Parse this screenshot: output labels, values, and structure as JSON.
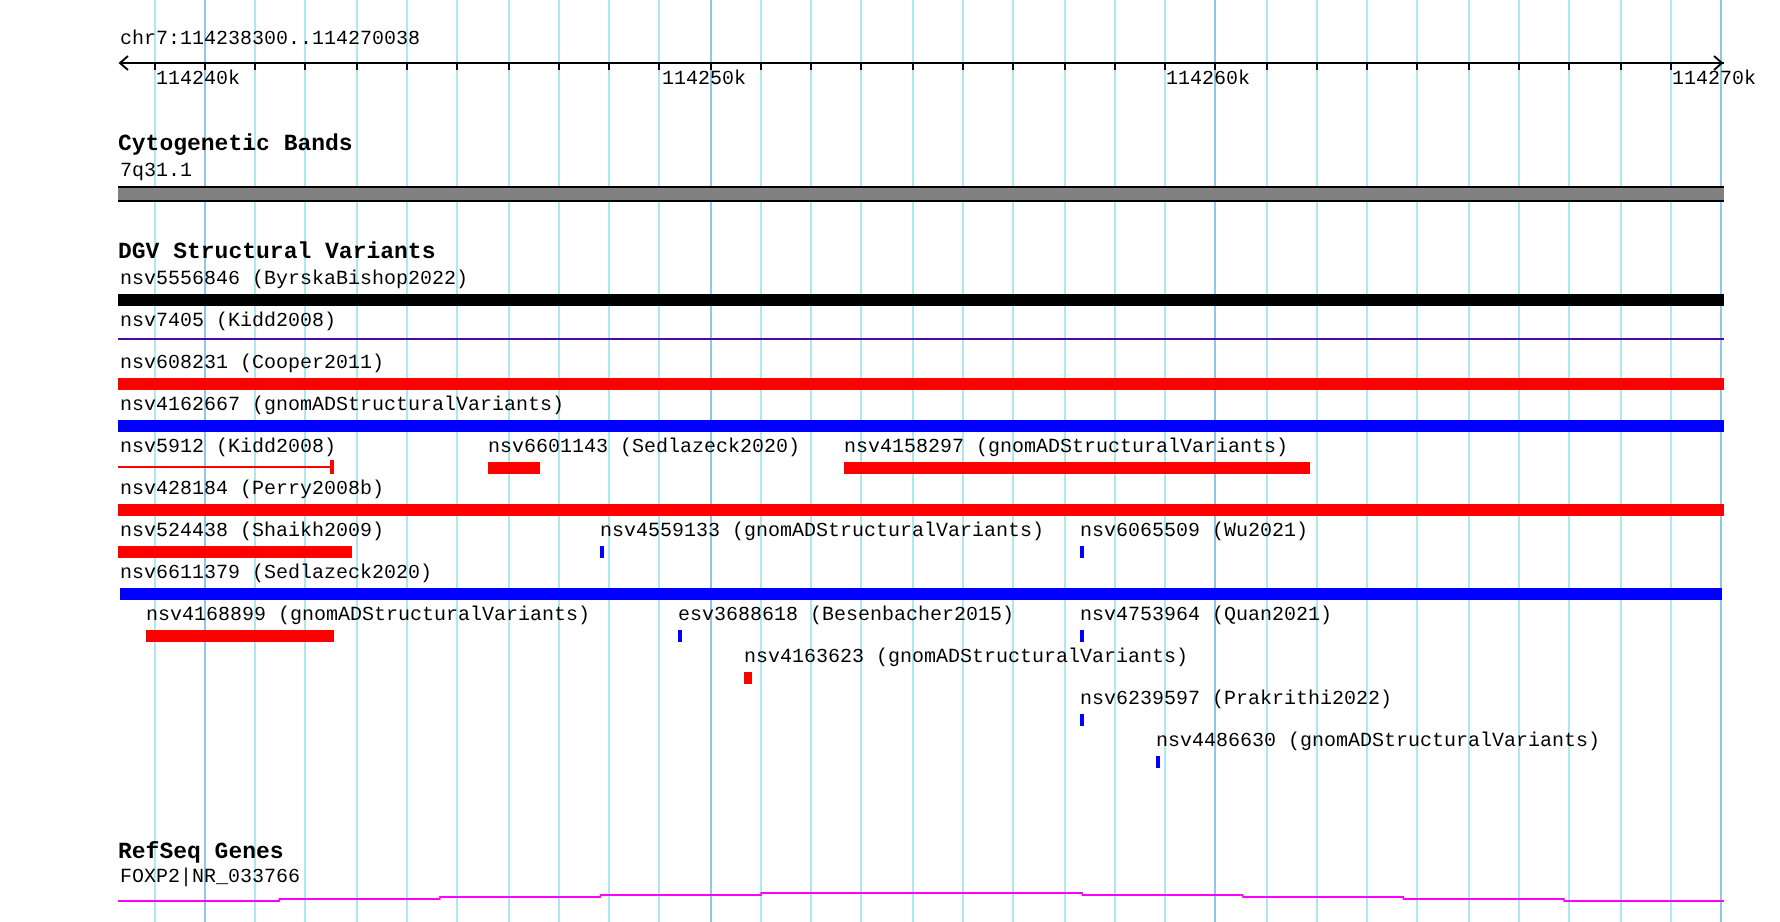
{
  "ruler": {
    "location": "chr7:114238300..114270038",
    "ticks": [
      "114240k",
      "114250k",
      "114260k",
      "114270k"
    ]
  },
  "cytogenetic_bands": {
    "title": "Cytogenetic Bands",
    "band": {
      "label": "7q31.1"
    }
  },
  "dgv_structural_variants": {
    "title": "DGV Structural Variants",
    "features": [
      {
        "label": "nsv5556846 (ByrskaBishop2022)",
        "color": "#000000",
        "kind": "bar"
      },
      {
        "label": "nsv7405 (Kidd2008)",
        "color": "#4b0c9a",
        "kind": "line"
      },
      {
        "label": "nsv608231 (Cooper2011)",
        "color": "#ff0000",
        "kind": "bar"
      },
      {
        "label": "nsv4162667 (gnomADStructuralVariants)",
        "color": "#0000ff",
        "kind": "bar"
      },
      {
        "label": "nsv5912 (Kidd2008)",
        "color": "#ff0000",
        "kind": "line"
      },
      {
        "label": "nsv6601143 (Sedlazeck2020)",
        "color": "#ff0000",
        "kind": "bar"
      },
      {
        "label": "nsv4158297 (gnomADStructuralVariants)",
        "color": "#ff0000",
        "kind": "bar"
      },
      {
        "label": "nsv428184 (Perry2008b)",
        "color": "#ff0000",
        "kind": "bar"
      },
      {
        "label": "nsv524438 (Shaikh2009)",
        "color": "#ff0000",
        "kind": "bar"
      },
      {
        "label": "nsv4559133 (gnomADStructuralVariants)",
        "color": "#0000ff",
        "kind": "bar"
      },
      {
        "label": "nsv6065509 (Wu2021)",
        "color": "#0000ff",
        "kind": "bar"
      },
      {
        "label": "nsv6611379 (Sedlazeck2020)",
        "color": "#0000ff",
        "kind": "bar"
      },
      {
        "label": "nsv4168899 (gnomADStructuralVariants)",
        "color": "#ff0000",
        "kind": "bar"
      },
      {
        "label": "esv3688618 (Besenbacher2015)",
        "color": "#0000ff",
        "kind": "bar"
      },
      {
        "label": "nsv4753964 (Quan2021)",
        "color": "#0000ff",
        "kind": "bar"
      },
      {
        "label": "nsv4163623 (gnomADStructuralVariants)",
        "color": "#ff0000",
        "kind": "bar"
      },
      {
        "label": "nsv6239597 (Prakrithi2022)",
        "color": "#0000ff",
        "kind": "bar"
      },
      {
        "label": "nsv4486630 (gnomADStructuralVariants)",
        "color": "#0000ff",
        "kind": "bar"
      }
    ]
  },
  "refseq_genes": {
    "title": "RefSeq Genes",
    "gene": {
      "label": "FOXP2|NR_033766"
    }
  }
}
